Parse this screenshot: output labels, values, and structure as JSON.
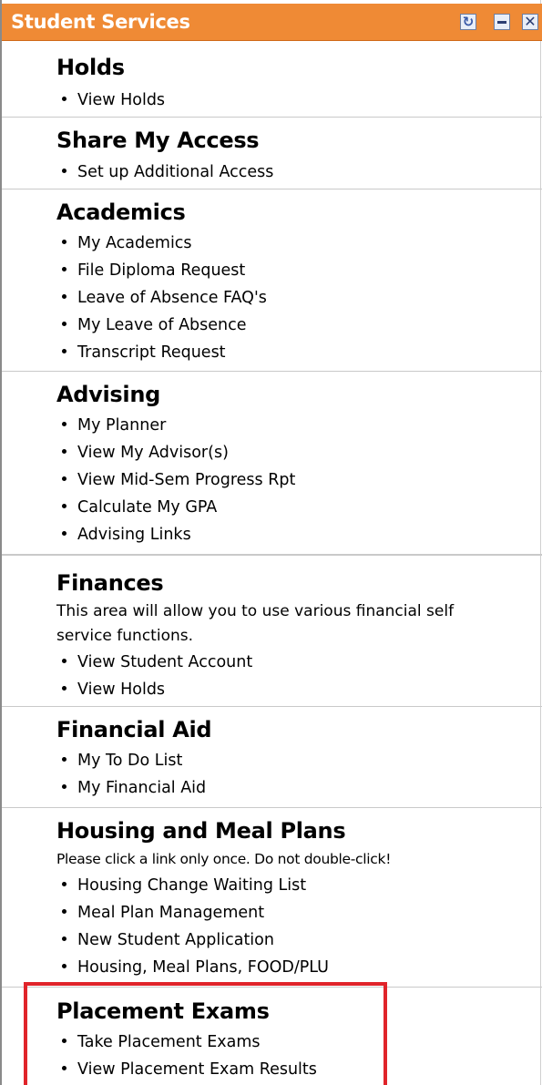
{
  "portlet": {
    "title": "Student Services",
    "header_icons": [
      "refresh-icon",
      "minimize-icon",
      "close-icon"
    ],
    "colors": {
      "header": "#ef8a35",
      "highlight": "#e0242a"
    }
  },
  "sections": [
    {
      "title": "Holds",
      "links": [
        "View Holds"
      ]
    },
    {
      "title": "Share My Access",
      "links": [
        "Set up Additional Access"
      ]
    },
    {
      "title": "Academics",
      "links": [
        "My Academics",
        "File Diploma Request",
        "Leave of Absence FAQ's",
        "My Leave of Absence",
        "Transcript Request"
      ]
    },
    {
      "title": "Advising",
      "links": [
        "My Planner",
        "View My Advisor(s)",
        "View Mid-Sem Progress Rpt",
        "Calculate My GPA",
        "Advising Links"
      ]
    },
    {
      "title": "Finances",
      "description": "This area will allow you to use various financial self service functions.",
      "links": [
        "View Student Account",
        "View Holds"
      ]
    },
    {
      "title": "Financial Aid",
      "links": [
        "My To Do List",
        "My Financial Aid"
      ]
    },
    {
      "title": "Housing and Meal Plans",
      "description": "Please click a link only once. Do not double-click!",
      "links": [
        "Housing Change Waiting List",
        "Meal Plan Management",
        "New Student Application",
        "Housing, Meal Plans, FOOD/PLU"
      ]
    },
    {
      "title": "Placement Exams",
      "highlighted": true,
      "links": [
        "Take Placement Exams",
        "View Placement Exam Results"
      ]
    }
  ]
}
